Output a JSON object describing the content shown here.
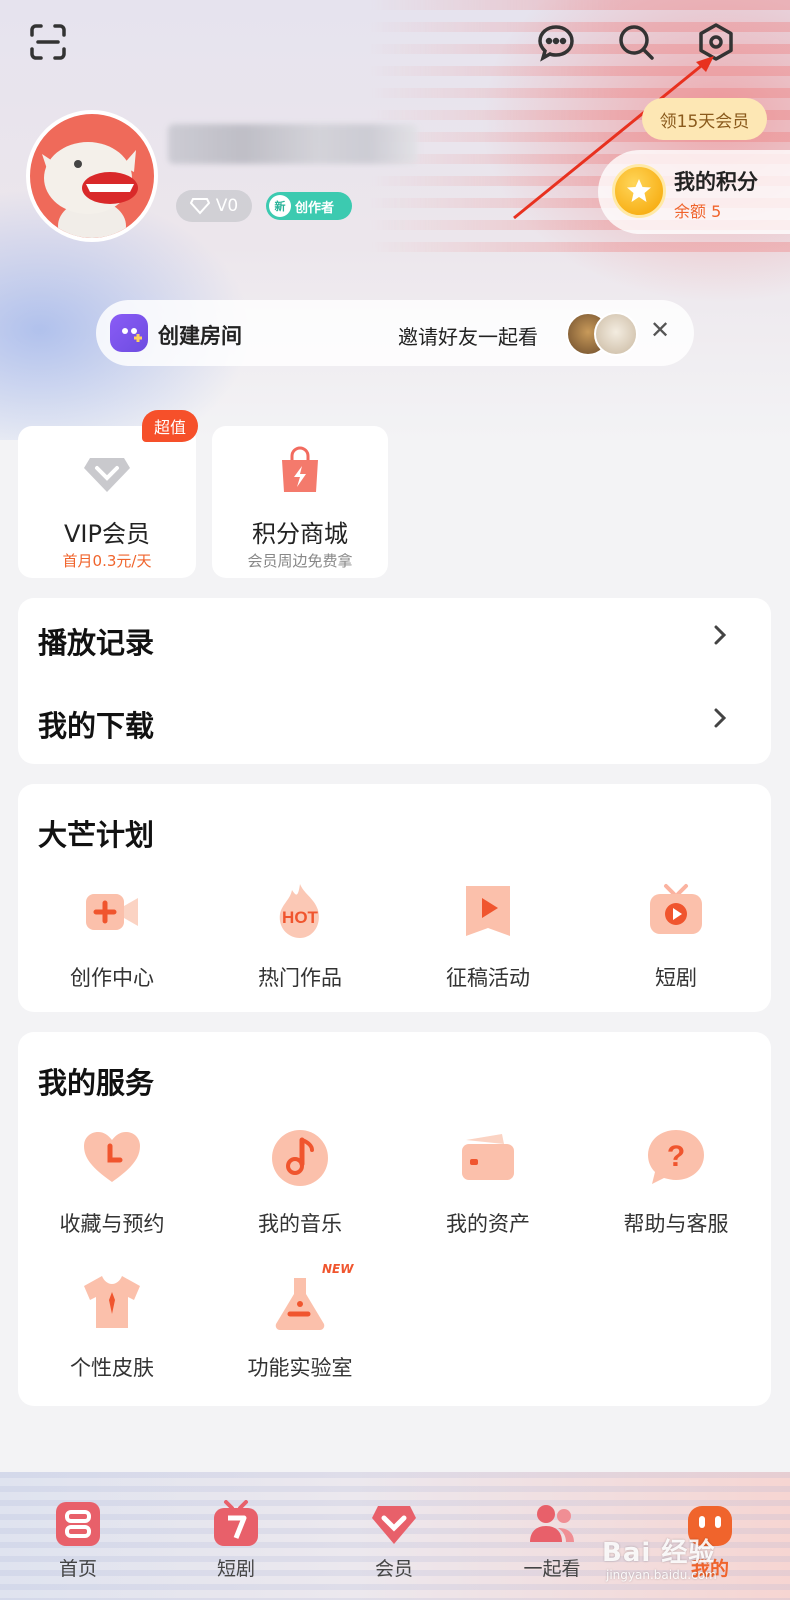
{
  "header": {
    "icons": [
      "scan-icon",
      "message-icon",
      "search-icon",
      "settings-icon"
    ]
  },
  "profile": {
    "level_badge": "V0",
    "creator_badge_new": "新",
    "creator_badge_label": "创作者"
  },
  "points": {
    "vip_tip": "领15天会员",
    "title": "我的积分",
    "balance": "余额 5"
  },
  "room": {
    "title": "创建房间",
    "invite": "邀请好友一起看",
    "close": "✕"
  },
  "tiles": [
    {
      "title": "VIP会员",
      "sub": "首月0.3元/天",
      "tag": "超值"
    },
    {
      "title": "积分商城",
      "sub": "会员周边免费拿"
    }
  ],
  "records": [
    {
      "label": "播放记录"
    },
    {
      "label": "我的下载"
    }
  ],
  "plan": {
    "title": "大芒计划",
    "items": [
      "创作中心",
      "热门作品",
      "征稿活动",
      "短剧"
    ]
  },
  "services": {
    "title": "我的服务",
    "items": [
      "收藏与预约",
      "我的音乐",
      "我的资产",
      "帮助与客服",
      "个性皮肤",
      "功能实验室"
    ],
    "new_tag": "NEW"
  },
  "nav": {
    "items": [
      "首页",
      "短剧",
      "会员",
      "一起看",
      "我的"
    ],
    "active": "我的"
  },
  "watermark": {
    "brand": "Bai 经验",
    "url": "jingyan.baidu.com"
  },
  "colors": {
    "accent": "#f0642c",
    "creator": "#3ccab0",
    "room_icon": "#7a55ea"
  }
}
